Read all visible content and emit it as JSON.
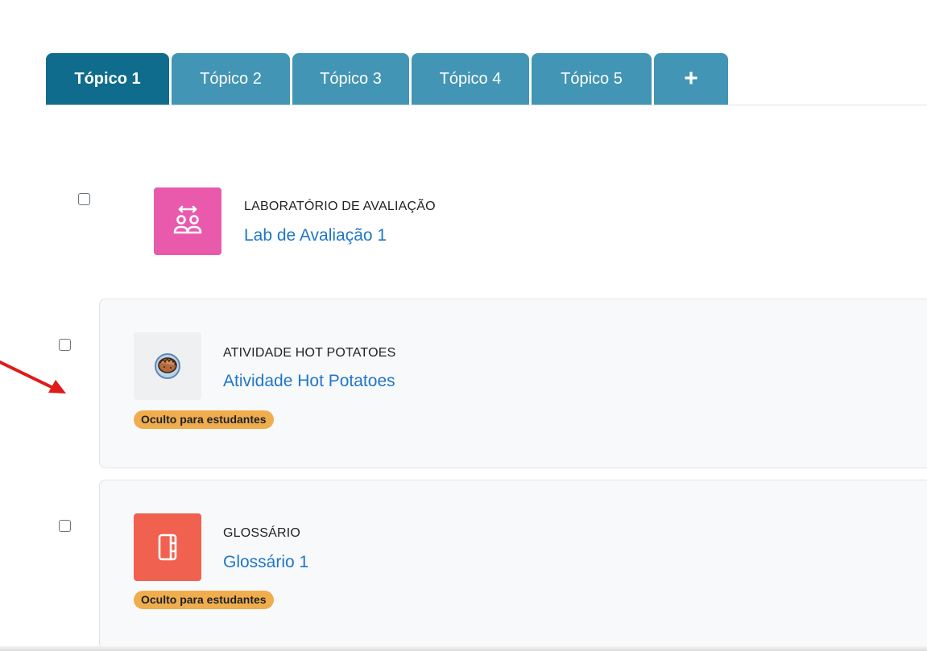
{
  "tabs": [
    {
      "label": "Tópico 1",
      "active": true
    },
    {
      "label": "Tópico 2",
      "active": false
    },
    {
      "label": "Tópico 3",
      "active": false
    },
    {
      "label": "Tópico 4",
      "active": false
    },
    {
      "label": "Tópico 5",
      "active": false
    }
  ],
  "add_tab_label": "+",
  "activities": [
    {
      "type_label": "LABORATÓRIO DE AVALIAÇÃO",
      "name": "Lab de Avaliação 1",
      "icon": "workshop-people-icon",
      "icon_color": "#e95aad"
    },
    {
      "type_label": "ATIVIDADE HOT POTATOES",
      "name": "Atividade Hot Potatoes",
      "icon": "hand-holding-potato-icon",
      "icon_color": "#eef0f2",
      "badge": "Oculto para estudantes"
    },
    {
      "type_label": "GLOSSÁRIO",
      "name": "Glossário 1",
      "icon": "book-icon",
      "icon_color": "#f0614f",
      "badge": "Oculto para estudantes"
    }
  ],
  "colors": {
    "tab_active": "#0f6c8c",
    "tab_inactive": "#4295b4",
    "link": "#1f76c9",
    "badge": "#f0ad4e",
    "annotation_arrow": "#e01a1a"
  }
}
